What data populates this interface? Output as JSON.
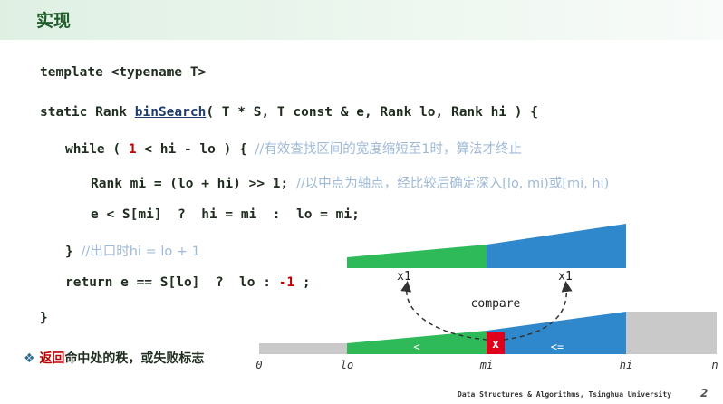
{
  "title": "实现",
  "code": {
    "line1": "template <typename T>",
    "line2_a": "static Rank ",
    "line2_fn": "binSearch",
    "line2_b": "( T * S, T const & e, Rank lo, Rank hi ) {",
    "line3_a": "while ( ",
    "line3_num": "1",
    "line3_b": " < hi - lo ) { ",
    "line3_cm": "//有效查找区间的宽度缩短至1时，算法才终止",
    "line4_a": "Rank mi = (lo + hi) >> 1; ",
    "line4_cm": "//以中点为轴点，经比较后确定深入[lo, mi)或[mi, hi)",
    "line5": "e < S[mi]  ?  hi = mi  :  lo = mi;",
    "line6_a": "} ",
    "line6_cm": "//出口时hi = lo + 1",
    "line7_a": "return e == S[lo]  ?  lo : ",
    "line7_num": "-1",
    "line7_b": " ;",
    "line8": "}"
  },
  "note": {
    "marker": "❖",
    "red": "返回",
    "rest": "命中处的秩，或失败标志"
  },
  "diagram": {
    "left_label": "x1",
    "right_label": "x1",
    "compare": "compare",
    "lt": "<",
    "x": "x",
    "le": "<=",
    "axis_0": "0",
    "axis_lo": "lo",
    "axis_mi": "mi",
    "axis_hi": "hi",
    "axis_n": "n",
    "colors": {
      "green": "#2fba5a",
      "blue": "#2f88cc",
      "gray": "#c9c9c9",
      "red": "#e0001b"
    }
  },
  "footer": "Data Structures & Algorithms, Tsinghua University",
  "page_number": "2"
}
